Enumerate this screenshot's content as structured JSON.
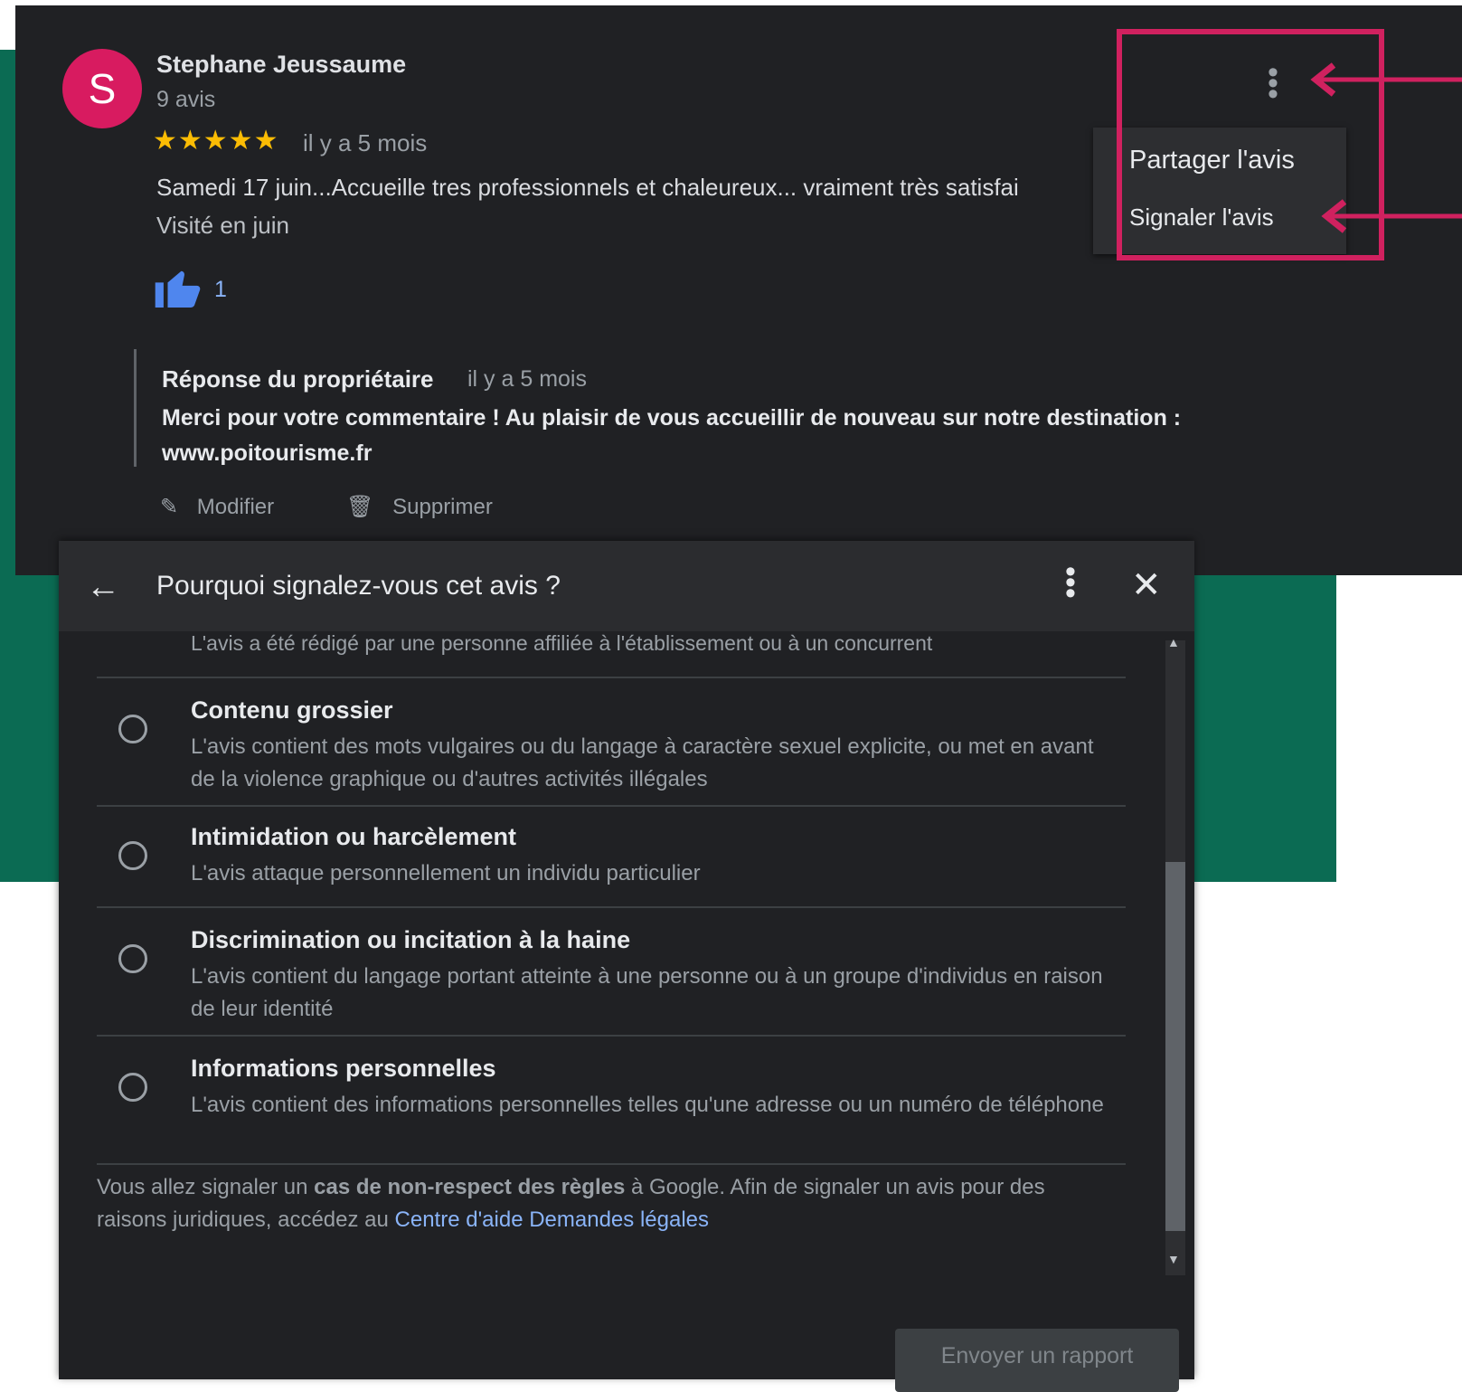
{
  "review": {
    "avatar_letter": "S",
    "author": "Stephane Jeussaume",
    "review_count": "9 avis",
    "stars": "★★★★★",
    "date": "il y a 5 mois",
    "text": "Samedi 17 juin...Accueille tres professionnels et chaleureux... vraiment très satisfai",
    "visited": "Visité en juin",
    "likes": "1",
    "reply_title": "Réponse du propriétaire",
    "reply_date": "il y a 5 mois",
    "reply_text": "Merci pour votre commentaire ! Au plaisir de vous accueillir de nouveau sur notre destination : www.poitourisme.fr",
    "edit_label": "Modifier",
    "delete_label": "Supprimer"
  },
  "menu": {
    "share": "Partager l'avis",
    "report": "Signaler l'avis"
  },
  "dialog": {
    "title": "Pourquoi signalez-vous cet avis ?",
    "partial_option": "L'avis a été rédigé par une personne affiliée à l'établissement ou à un concurrent",
    "options": [
      {
        "title": "Contenu grossier",
        "desc": "L'avis contient des mots vulgaires ou du langage à caractère sexuel explicite, ou met en avant de la violence graphique ou d'autres activités illégales"
      },
      {
        "title": "Intimidation ou harcèlement",
        "desc": "L'avis attaque personnellement un individu particulier"
      },
      {
        "title": "Discrimination ou incitation à la haine",
        "desc": "L'avis contient du langage portant atteinte à une personne ou à un groupe d'individus en raison de leur identité"
      },
      {
        "title": "Informations personnelles",
        "desc": "L'avis contient des informations personnelles telles qu'une adresse ou un numéro de téléphone"
      }
    ],
    "footer_pre": "Vous allez signaler un ",
    "footer_bold": "cas de non-respect des règles",
    "footer_post": " à Google. Afin de signaler un avis pour des raisons juridiques, accédez au ",
    "footer_link": "Centre d'aide Demandes légales",
    "send_button": "Envoyer un rapport"
  },
  "colors": {
    "highlight": "#d0215f",
    "background_green": "#0b6b53",
    "avatar": "#d81b60",
    "link": "#8ab4f8"
  }
}
